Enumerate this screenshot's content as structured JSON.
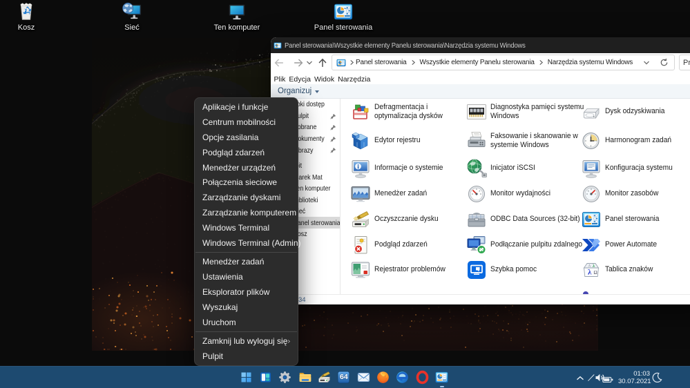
{
  "desktop": {
    "icons": [
      {
        "id": "recycle-bin",
        "label": "Kosz"
      },
      {
        "id": "network",
        "label": "Sieć"
      },
      {
        "id": "this-pc",
        "label": "Ten komputer"
      },
      {
        "id": "control-panel",
        "label": "Panel sterowania"
      }
    ]
  },
  "explorer": {
    "title": "Panel sterowania\\Wszystkie elementy Panelu sterowania\\Narzędzia systemu Windows",
    "toolbar": {
      "breadcrumb": [
        "Panel sterowania",
        "Wszystkie elementy Panelu sterowania",
        "Narzędzia systemu Windows"
      ],
      "search_text": "Prz"
    },
    "menubar": [
      "Plik",
      "Edycja",
      "Widok",
      "Narzędzia"
    ],
    "command_bar": {
      "organize": "Organizuj"
    },
    "sidebar": [
      {
        "label": "Szybki dostęp",
        "level": 0
      },
      {
        "label": "Pulpit",
        "level": 1,
        "pinned": true
      },
      {
        "label": "Pobrane",
        "level": 1,
        "pinned": true
      },
      {
        "label": "Dokumenty",
        "level": 1,
        "pinned": true
      },
      {
        "label": "Obrazy",
        "level": 1,
        "pinned": true
      },
      {
        "label": "Pulpit",
        "level": 0,
        "section": true
      },
      {
        "label": "Marek Mat",
        "level": 1
      },
      {
        "label": "Ten komputer",
        "level": 1
      },
      {
        "label": "Biblioteki",
        "level": 1
      },
      {
        "label": "Sieć",
        "level": 1
      },
      {
        "label": "Panel sterowania",
        "level": 1,
        "selected": true
      },
      {
        "label": "Kosz",
        "level": 1
      }
    ],
    "files": [
      {
        "icon": "defrag",
        "label": "Defragmentacja i optymalizacja dysków"
      },
      {
        "icon": "memory-diagnostic",
        "label": "Diagnostyka pamięci systemu Windows"
      },
      {
        "icon": "recovery-drive",
        "label": "Dysk odzyskiwania"
      },
      {
        "icon": "registry-editor",
        "label": "Edytor rejestru"
      },
      {
        "icon": "fax-scan",
        "label": "Faksowanie i skanowanie w systemie Windows"
      },
      {
        "icon": "task-scheduler",
        "label": "Harmonogram zadań"
      },
      {
        "icon": "system-info",
        "label": "Informacje o systemie"
      },
      {
        "icon": "iscsi-initiator",
        "label": "Inicjator iSCSI"
      },
      {
        "icon": "system-config",
        "label": "Konfiguracja systemu"
      },
      {
        "icon": "task-manager",
        "label": "Menedżer zadań"
      },
      {
        "icon": "performance-monitor",
        "label": "Monitor wydajności"
      },
      {
        "icon": "resource-monitor",
        "label": "Monitor zasobów"
      },
      {
        "icon": "disk-cleanup",
        "label": "Oczyszczanie dysku"
      },
      {
        "icon": "odbc",
        "label": "ODBC Data Sources (32-bit)"
      },
      {
        "icon": "control-panel-small",
        "label": "Panel sterowania"
      },
      {
        "icon": "event-viewer",
        "label": "Podgląd zdarzeń"
      },
      {
        "icon": "remote-desktop",
        "label": "Podłączanie pulpitu zdalnego"
      },
      {
        "icon": "power-automate",
        "label": "Power Automate"
      },
      {
        "icon": "steps-recorder",
        "label": "Rejestrator problemów"
      },
      {
        "icon": "quick-assist",
        "label": "Szybka pomoc"
      },
      {
        "icon": "character-map",
        "label": "Tablica znaków"
      }
    ],
    "status": {
      "items_count": "34"
    }
  },
  "context_menu": {
    "items": [
      {
        "label": "Aplikacje i funkcje"
      },
      {
        "label": "Centrum mobilności"
      },
      {
        "label": "Opcje zasilania"
      },
      {
        "label": "Podgląd zdarzeń"
      },
      {
        "label": "Menedżer urządzeń"
      },
      {
        "label": "Połączenia sieciowe"
      },
      {
        "label": "Zarządzanie dyskami"
      },
      {
        "label": "Zarządzanie komputerem"
      },
      {
        "label": "Windows Terminal"
      },
      {
        "label": "Windows Terminal (Admin)"
      },
      {
        "separator": true
      },
      {
        "label": "Menedżer zadań"
      },
      {
        "label": "Ustawienia"
      },
      {
        "label": "Eksplorator plików"
      },
      {
        "label": "Wyszukaj"
      },
      {
        "label": "Uruchom"
      },
      {
        "separator": true
      },
      {
        "label": "Zamknij lub wyloguj się",
        "submenu": true
      },
      {
        "label": "Pulpit"
      }
    ]
  },
  "taskbar": {
    "buttons": [
      {
        "id": "start"
      },
      {
        "id": "widgets"
      },
      {
        "id": "settings"
      },
      {
        "id": "file-explorer"
      },
      {
        "id": "disk-cleanup"
      },
      {
        "id": "total-commander",
        "badge": "64"
      },
      {
        "id": "mail"
      },
      {
        "id": "firefox"
      },
      {
        "id": "edge"
      },
      {
        "id": "opera"
      },
      {
        "id": "control-panel",
        "active": true
      }
    ],
    "tray": {
      "time": "01:03",
      "date": "30.07.2021"
    }
  },
  "colors": {
    "taskbar": "#1d4a70",
    "menu_bg": "#2c2c2c",
    "selection": "#d9d9d9",
    "accent_blue": "#2a66b8"
  }
}
